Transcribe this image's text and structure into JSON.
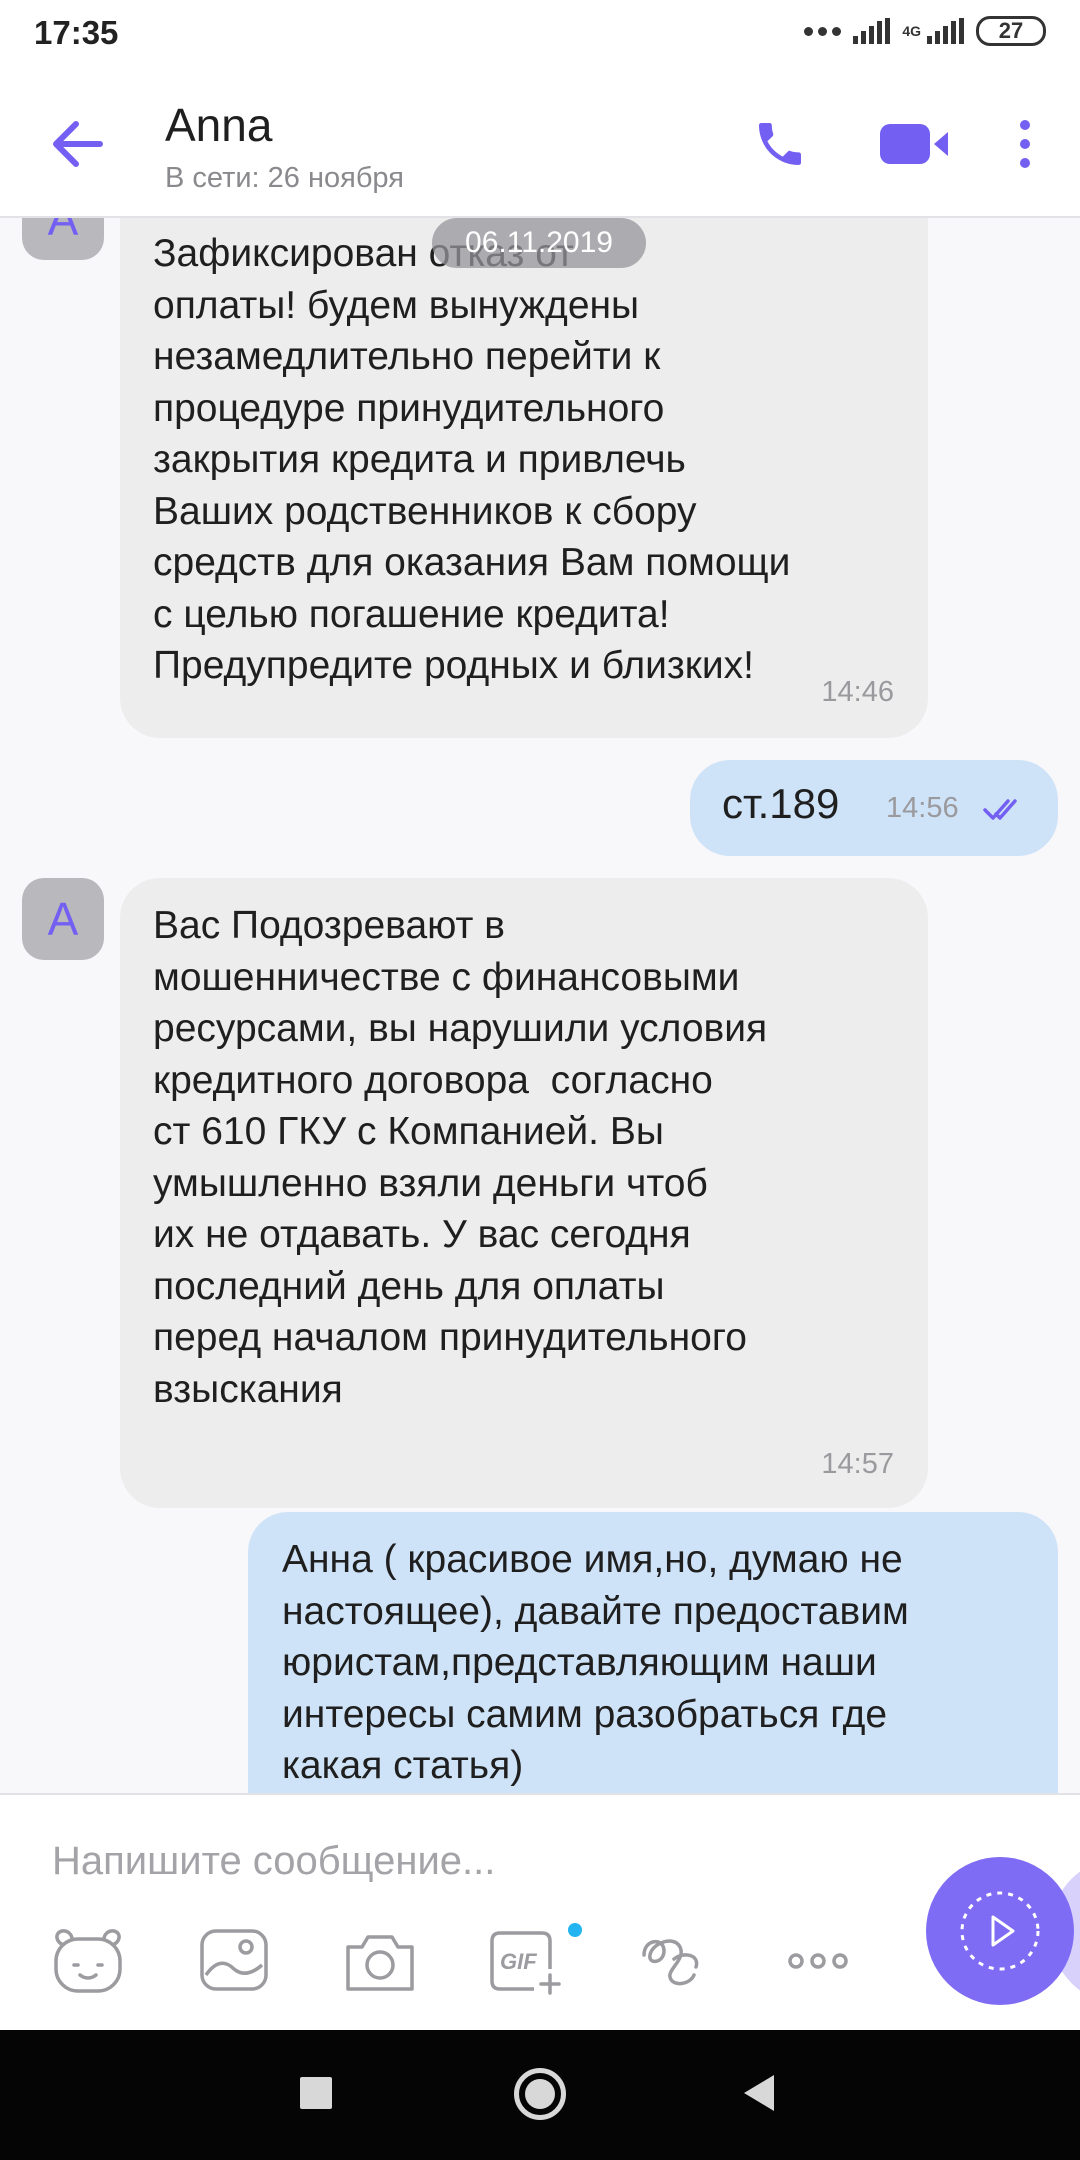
{
  "status_bar": {
    "time": "17:35",
    "network": "4G",
    "battery": "27"
  },
  "header": {
    "contact_name": "Anna",
    "contact_status": "В сети: 26 ноября",
    "icons": [
      "back-arrow-icon",
      "phone-icon",
      "video-camera-icon",
      "more-vertical-icon"
    ],
    "accent_color": "#7360f2"
  },
  "chat": {
    "date_label": "06.11.2019",
    "messages": [
      {
        "direction": "incoming",
        "avatar_letter": "A",
        "text": "Зафиксирован отказ от\nоплаты! будем вынуждены\nнезамедлительно перейти к\nпроцедуре принудительного\nзакрытия кредита и привлечь\nВаших родственников к сбору\nсредств для оказания Вам помощи\nс целью погашение кредита!\nПредупредите родных и близких!",
        "time": "14:46"
      },
      {
        "direction": "outgoing",
        "text": "ст.189",
        "time": "14:56",
        "status": "read"
      },
      {
        "direction": "incoming",
        "avatar_letter": "A",
        "text": "Вас Подозревают в\nмошенничестве с финансовыми\nресурсами, вы нарушили условия\nкредитного договора  согласно\nст 610 ГКУ с Компанией. Вы\nумышленно взяли деньги чтоб\nих не отдавать. У вас сегодня\nпоследний день для оплаты\nперед началом принудительного\nвзыскания",
        "time": "14:57"
      },
      {
        "direction": "outgoing",
        "text": "Анна ( красивое имя,но, думаю не\nнастоящее), давайте предоставим\nюристам,представляющим наши\nинтересы самим разобраться где\nкакая статья)"
      }
    ],
    "incoming_bubble_color": "#ededee",
    "outgoing_bubble_color": "#cfe3f8"
  },
  "composer": {
    "placeholder": "Напишите сообщение...",
    "tools": [
      "sticker-icon",
      "gallery-icon",
      "camera-icon",
      "gif-icon",
      "doodle-icon",
      "more-icon"
    ],
    "gif_label": "GIF"
  },
  "nav_bar": {
    "icons": [
      "recents-icon",
      "home-icon",
      "back-icon"
    ]
  }
}
